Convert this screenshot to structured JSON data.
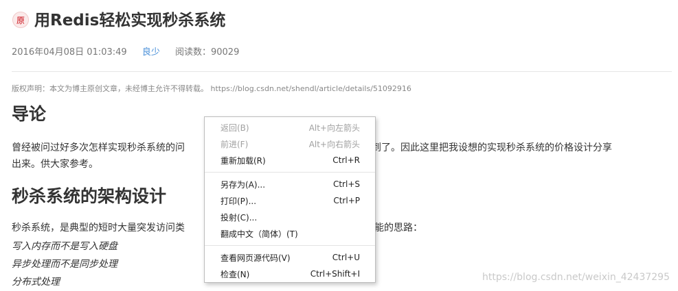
{
  "article": {
    "original_badge": "原",
    "title": "用Redis轻松实现秒杀系统",
    "date": "2016年04月08日 01:03:49",
    "author": "良少",
    "read_count": "阅读数：90029",
    "copyright": "版权声明：本文为博主原创文章，未经博主允许不得转载。 https://blog.csdn.net/shendl/article/details/51092916",
    "heading_intro": "导论",
    "intro_para_left": "曾经被问过好多次怎样实现秒杀系统的问",
    "intro_para_right": "被问到了。因此这里把我设想的实现秒杀系统的价格设计分享",
    "intro_para_line2": "出来。供大家参考。",
    "heading_arch": "秒杀系统的架构设计",
    "arch_para_left": "秒杀系统，是典型的短时大量突发访问类",
    "arch_para_right": "能的思路：",
    "list": [
      "写入内存而不是写入硬盘",
      "异步处理而不是同步处理",
      "分布式处理"
    ],
    "watermark": "https://blog.csdn.net/weixin_42437295"
  },
  "context_menu": {
    "back": {
      "label": "返回(B)",
      "shortcut": "Alt+向左箭头"
    },
    "forward": {
      "label": "前进(F)",
      "shortcut": "Alt+向右箭头"
    },
    "reload": {
      "label": "重新加载(R)",
      "shortcut": "Ctrl+R"
    },
    "save_as": {
      "label": "另存为(A)...",
      "shortcut": "Ctrl+S"
    },
    "print": {
      "label": "打印(P)...",
      "shortcut": "Ctrl+P"
    },
    "cast": {
      "label": "投射(C)...",
      "shortcut": ""
    },
    "translate": {
      "label": "翻成中文（简体）(T)",
      "shortcut": ""
    },
    "view_source": {
      "label": "查看网页源代码(V)",
      "shortcut": "Ctrl+U"
    },
    "inspect": {
      "label": "检查(N)",
      "shortcut": "Ctrl+Shift+I"
    }
  },
  "colors": {
    "author_link": "#4a90d9",
    "badge": "#ca0c16",
    "disabled_text": "#a0a0a0"
  }
}
